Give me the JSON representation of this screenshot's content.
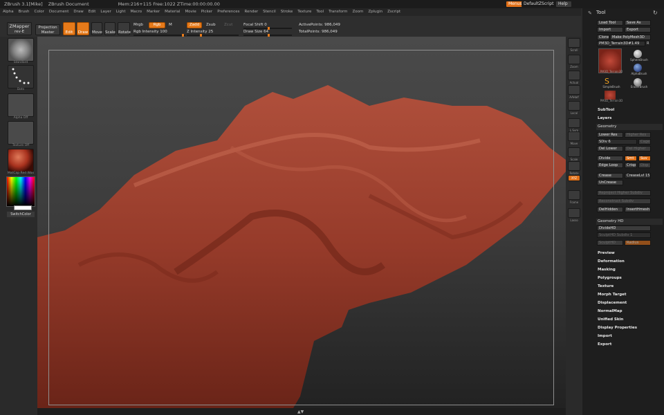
{
  "app": {
    "title": "ZBrush 3.1[Mike]",
    "document": "ZBrush Document",
    "mem": "Mem:216+115 Free:1022 ZTime:00:00:00.00",
    "buttons": {
      "menus": "Menus",
      "script": "DefaultZScript",
      "help": "Help"
    }
  },
  "menubar": [
    "Alpha",
    "Brush",
    "Color",
    "Document",
    "Draw",
    "Edit",
    "Layer",
    "Light",
    "Macro",
    "Marker",
    "Material",
    "Movie",
    "Picker",
    "Preferences",
    "Render",
    "Stencil",
    "Stroke",
    "Texture",
    "Tool",
    "Transform",
    "Zoom",
    "Zplugin",
    "Zscript"
  ],
  "toolbar": {
    "zmapper": "ZMapper",
    "zmapper_sub": "rev-E",
    "projection": "Projection",
    "master": "Master",
    "edit": "Edit",
    "draw": "Draw",
    "move": "Move",
    "scale": "Scale",
    "rotate": "Rotate",
    "mrgb": "Mrgb",
    "rgb": "Rgb",
    "m": "M",
    "zadd": "Zadd",
    "zsub": "Zsub",
    "zcut": "Zcut",
    "rgb_intensity": "Rgb Intensity 100",
    "z_intensity": "Z Intensity 25",
    "focal_shift": "Focal Shift 0",
    "draw_size": "Draw Size 64",
    "active_points": "ActivePoints: 986,049",
    "total_points": "TotalPoints: 986,049"
  },
  "leftshelf": {
    "brush": "Standard",
    "stroke": "Dots",
    "alpha": "Alpha Off",
    "texture": "Texture Off",
    "material": "MatCap Red Wax",
    "switchcolor": "SwitchColor"
  },
  "rightshelf": [
    "Scroll",
    "Zoom",
    "Actual",
    "AAHalf",
    "Local",
    "L.Sym",
    "Move",
    "Scale",
    "Rotate",
    "XYZ",
    "Frame",
    "Lasso"
  ],
  "palette": {
    "title": "Tool",
    "load": "Load Tool",
    "save": "Save As",
    "import": "Import",
    "export": "Export",
    "clone": "Clone",
    "make": "Make PolyMesh3D",
    "current": "PM3D_Terrain3D#1.49",
    "r": "R",
    "tools": [
      "PM3D_Terrain3D",
      "SphereBrush",
      "AlphaBrush",
      "SimpleBrush",
      "EraserBrush",
      "PM3D_Terrain3D"
    ],
    "subtool": "SubTool",
    "layers": "Layers",
    "geometry": "Geometry",
    "lower_res": "Lower Res",
    "higher_res": "Higher Res",
    "sdiv": "SDiv 6",
    "cage": "Cage",
    "del_lower": "Del Lower",
    "del_higher": "Del Higher",
    "divide": "Divide",
    "smt": "Smt",
    "suv": "Suv",
    "edge_loop": "Edge Loop",
    "crisp": "Crisp",
    "disp": "Disp",
    "crease": "Crease",
    "crease_lvl": "CreaseLvl 15",
    "uncrease": "UnCrease",
    "reproject": "Reproject Higher Subdiv",
    "reconstruct": "Reconstruct Subdiv",
    "delhidden": "DelHidden",
    "inserthmesh": "InsertHmesh",
    "geometry_hd": "Geometry HD",
    "dividehd": "DivideHD",
    "sculpthd_subdiv": "SculptHD Subdiv 1",
    "sculpthd": "SculptHD",
    "radius": "Radius",
    "sections": [
      "Preview",
      "Deformation",
      "Masking",
      "Polygroups",
      "Texture",
      "Morph Target",
      "Displacement",
      "NormalMap",
      "Unified Skin",
      "Display Properties",
      "Import",
      "Export"
    ]
  },
  "colors": {
    "accent": "#e07018",
    "terrain": "#9a3c2a"
  }
}
